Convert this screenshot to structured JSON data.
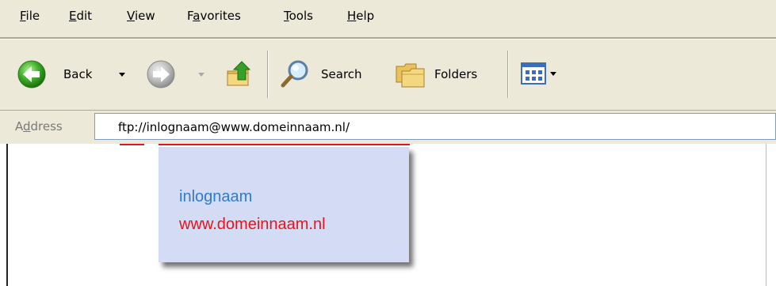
{
  "menu": {
    "items": [
      {
        "key": "F",
        "rest": "ile"
      },
      {
        "key": "E",
        "rest": "dit"
      },
      {
        "key": "V",
        "rest": "iew"
      },
      {
        "pre": "F",
        "key": "a",
        "rest": "vorites"
      },
      {
        "key": "T",
        "rest": "ools"
      },
      {
        "key": "H",
        "rest": "elp"
      }
    ]
  },
  "toolbar": {
    "back_label": "Back",
    "search_label": "Search",
    "folders_label": "Folders",
    "icons": [
      "back-arrow-icon",
      "forward-arrow-icon",
      "up-folder-icon",
      "search-magnifier-icon",
      "folders-icon",
      "views-grid-icon"
    ]
  },
  "address": {
    "label_pre": "A",
    "label_key": "d",
    "label_rest": "dress",
    "value": "ftp://inlognaam@www.domeinnaam.nl/"
  },
  "tooltip": {
    "username": "inlognaam",
    "host": "www.domeinnaam.nl"
  },
  "colors": {
    "chrome": "#ece9d8",
    "username": "#2e7ccd",
    "host": "#e8141b",
    "tooltip_bg": "#d4dbf4"
  }
}
